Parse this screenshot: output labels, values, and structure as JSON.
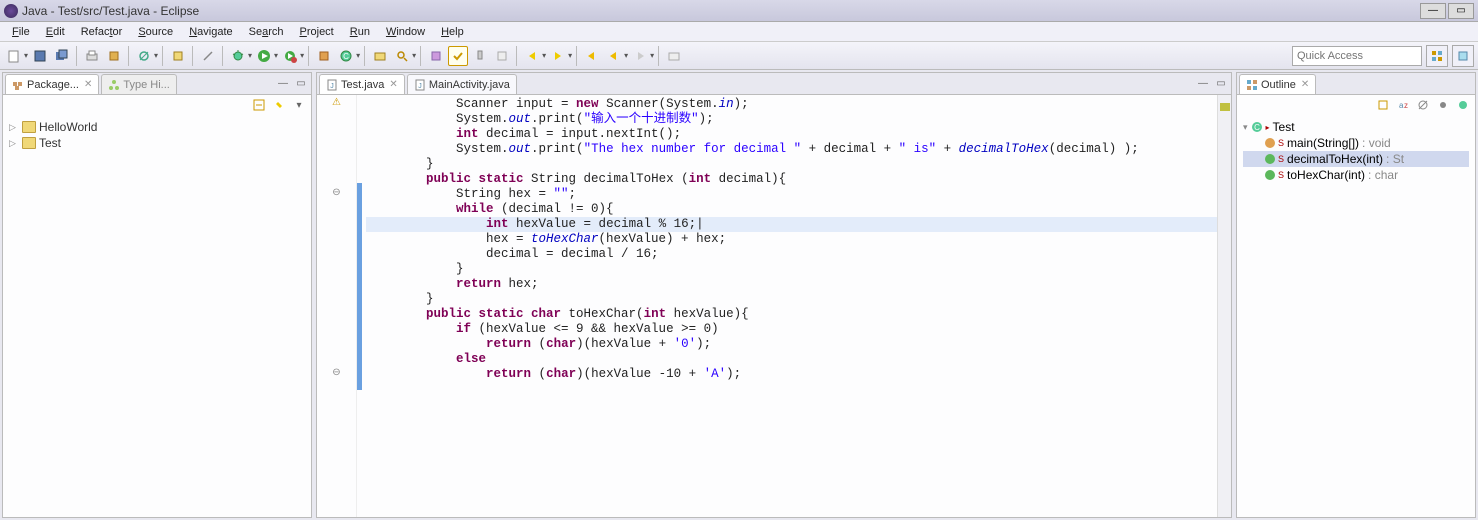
{
  "window": {
    "title": "Java - Test/src/Test.java - Eclipse"
  },
  "menu": [
    "File",
    "Edit",
    "Refactor",
    "Source",
    "Navigate",
    "Search",
    "Project",
    "Run",
    "Window",
    "Help"
  ],
  "quick_access_placeholder": "Quick Access",
  "package_explorer": {
    "tab_active": "Package...",
    "tab_inactive": "Type Hi...",
    "items": [
      "HelloWorld",
      "Test"
    ]
  },
  "editor": {
    "tabs": [
      {
        "label": "Test.java",
        "active": true
      },
      {
        "label": "MainActivity.java",
        "active": false
      }
    ],
    "code_lines": [
      {
        "indent": 3,
        "html": "Scanner input = <span class='kw'>new</span> Scanner(System.<span class='ital'>in</span>);"
      },
      {
        "indent": 3,
        "html": "System.<span class='ital'>out</span>.print(<span class='str'>\"输入一个十进制数\"</span>);"
      },
      {
        "indent": 3,
        "html": "<span class='kw'>int</span> decimal = input.nextInt();"
      },
      {
        "indent": 3,
        "html": "System.<span class='ital'>out</span>.print(<span class='str'>\"The hex number for decimal \"</span> + decimal + <span class='str'>\" is\"</span> + <span class='ital'>decimalToHex</span>(decimal) );"
      },
      {
        "indent": 2,
        "html": "}"
      },
      {
        "indent": 0,
        "html": ""
      },
      {
        "indent": 2,
        "html": "<span class='kw'>public static</span> String decimalToHex (<span class='kw'>int</span> decimal){",
        "mark": "⊖"
      },
      {
        "indent": 3,
        "html": "String hex = <span class='str'>\"\"</span>;"
      },
      {
        "indent": 0,
        "html": ""
      },
      {
        "indent": 3,
        "html": "<span class='kw'>while</span> (decimal != 0){"
      },
      {
        "indent": 4,
        "html": "<span class='kw'>int</span> hexValue = decimal % 16;|",
        "hl": true
      },
      {
        "indent": 4,
        "html": "hex = <span class='ital'>toHexChar</span>(hexValue) + hex;"
      },
      {
        "indent": 4,
        "html": "decimal = decimal / 16;"
      },
      {
        "indent": 3,
        "html": "}"
      },
      {
        "indent": 0,
        "html": ""
      },
      {
        "indent": 3,
        "html": "<span class='kw'>return</span> hex;"
      },
      {
        "indent": 2,
        "html": "}"
      },
      {
        "indent": 0,
        "html": ""
      },
      {
        "indent": 2,
        "html": "<span class='kw'>public static char</span> toHexChar(<span class='kw'>int</span> hexValue){",
        "mark": "⊖"
      },
      {
        "indent": 3,
        "html": "<span class='kw'>if</span> (hexValue &lt;= 9 &amp;&amp; hexValue &gt;= 0)"
      },
      {
        "indent": 4,
        "html": "<span class='kw'>return</span> (<span class='kw'>char</span>)(hexValue + <span class='str'>'0'</span>);"
      },
      {
        "indent": 3,
        "html": "<span class='kw'>else</span>"
      },
      {
        "indent": 4,
        "html": "<span class='kw'>return</span> (<span class='kw'>char</span>)(hexValue -10 + <span class='str'>'A'</span>);"
      }
    ]
  },
  "outline": {
    "title": "Outline",
    "class": "Test",
    "methods": [
      {
        "name": "main(String[])",
        "ret": "void",
        "kind": "orange"
      },
      {
        "name": "decimalToHex(int)",
        "ret": "St",
        "kind": "green",
        "hl": true
      },
      {
        "name": "toHexChar(int)",
        "ret": "char",
        "kind": "green"
      }
    ]
  }
}
